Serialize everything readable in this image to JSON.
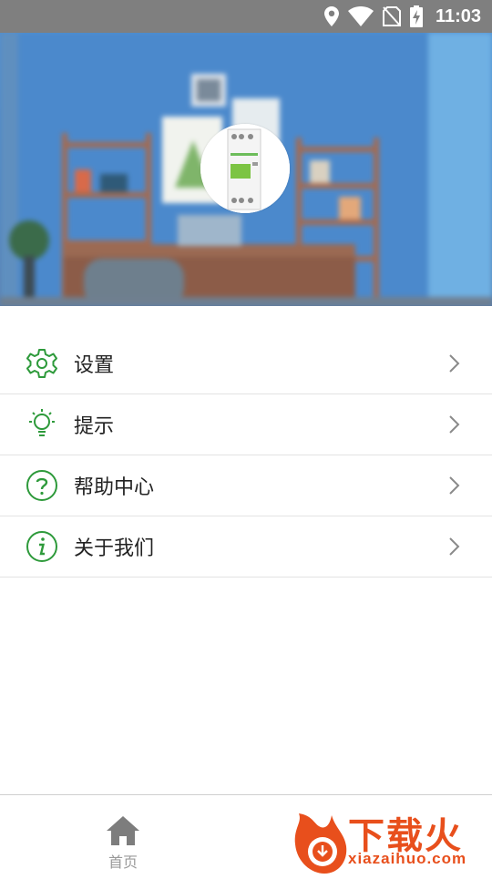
{
  "status_bar": {
    "time": "11:03",
    "icons": [
      "location-icon",
      "wifi-icon",
      "no-sim-icon",
      "battery-charging-icon"
    ]
  },
  "header": {
    "background": "blurred-room-photo",
    "avatar": "app-logo-thumbnail"
  },
  "menu": {
    "accent_color": "#2e9a3b",
    "items": [
      {
        "label": "设置",
        "icon": "gear-icon"
      },
      {
        "label": "提示",
        "icon": "lightbulb-icon"
      },
      {
        "label": "帮助中心",
        "icon": "question-circle-icon"
      },
      {
        "label": "关于我们",
        "icon": "info-circle-icon"
      }
    ]
  },
  "bottom_nav": {
    "home_label": "首页",
    "home_icon": "home-icon"
  },
  "watermark": {
    "text": "下载火",
    "url": "xiazaihuo.com",
    "color": "#e84f1c"
  }
}
